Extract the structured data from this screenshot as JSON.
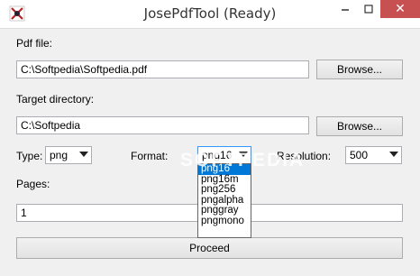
{
  "window": {
    "title": "JosePdfTool (Ready)",
    "min_glyph": "—",
    "max_glyph": "☐",
    "close_glyph": "✕"
  },
  "pdf_file": {
    "label": "Pdf file:",
    "value": "C:\\Softpedia\\Softpedia.pdf",
    "browse_label": "Browse..."
  },
  "target_dir": {
    "label": "Target directory:",
    "value": "C:\\Softpedia",
    "browse_label": "Browse..."
  },
  "type": {
    "label": "Type:",
    "selected": "png"
  },
  "format": {
    "label": "Format:",
    "selected": "png16",
    "options": [
      "png16",
      "png16m",
      "png256",
      "pngalpha",
      "pnggray",
      "pngmono"
    ]
  },
  "resolution": {
    "label": "Resolution:",
    "selected": "500"
  },
  "pages": {
    "label": "Pages:",
    "value": "1"
  },
  "proceed_label": "Proceed",
  "watermark": "SOFTPEDIA",
  "colors": {
    "close_button": "#c75050",
    "selection": "#0078d7"
  }
}
